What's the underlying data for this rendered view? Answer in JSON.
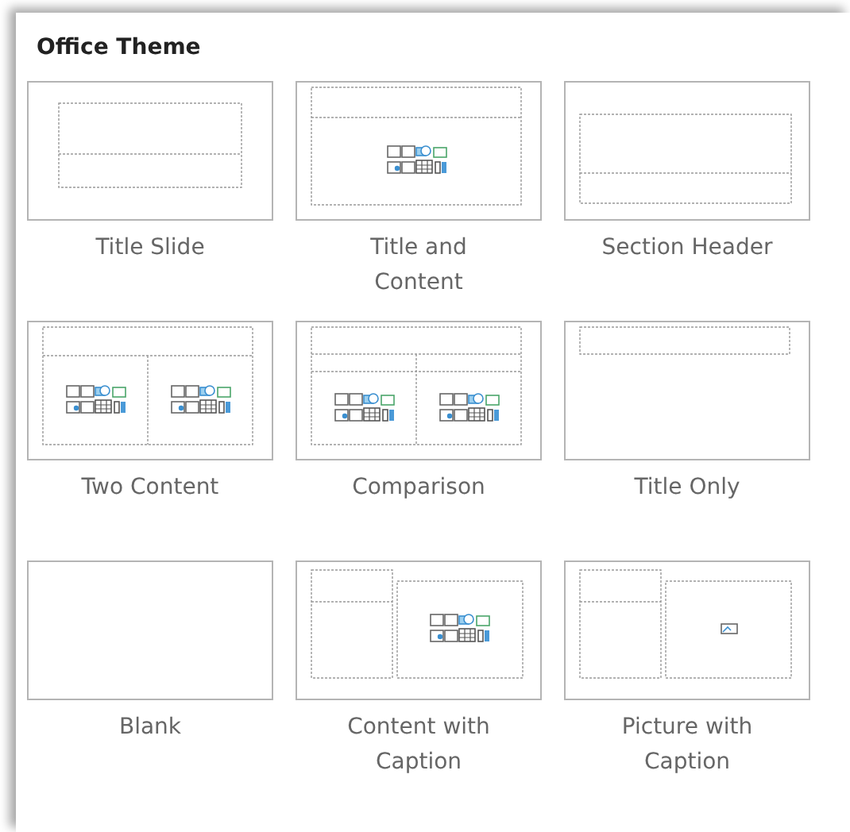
{
  "gallery": {
    "title": "Office Theme",
    "layouts": [
      {
        "label": "Title Slide",
        "kind": "title"
      },
      {
        "label": "Title and Content",
        "kind": "title-content"
      },
      {
        "label": "Section Header",
        "kind": "section"
      },
      {
        "label": "Two Content",
        "kind": "two"
      },
      {
        "label": "Comparison",
        "kind": "comparison"
      },
      {
        "label": "Title Only",
        "kind": "title-only"
      },
      {
        "label": "Blank",
        "kind": "blank"
      },
      {
        "label": "Content with Caption",
        "kind": "content-caption"
      },
      {
        "label": "Picture with Caption",
        "kind": "picture-caption"
      }
    ]
  }
}
